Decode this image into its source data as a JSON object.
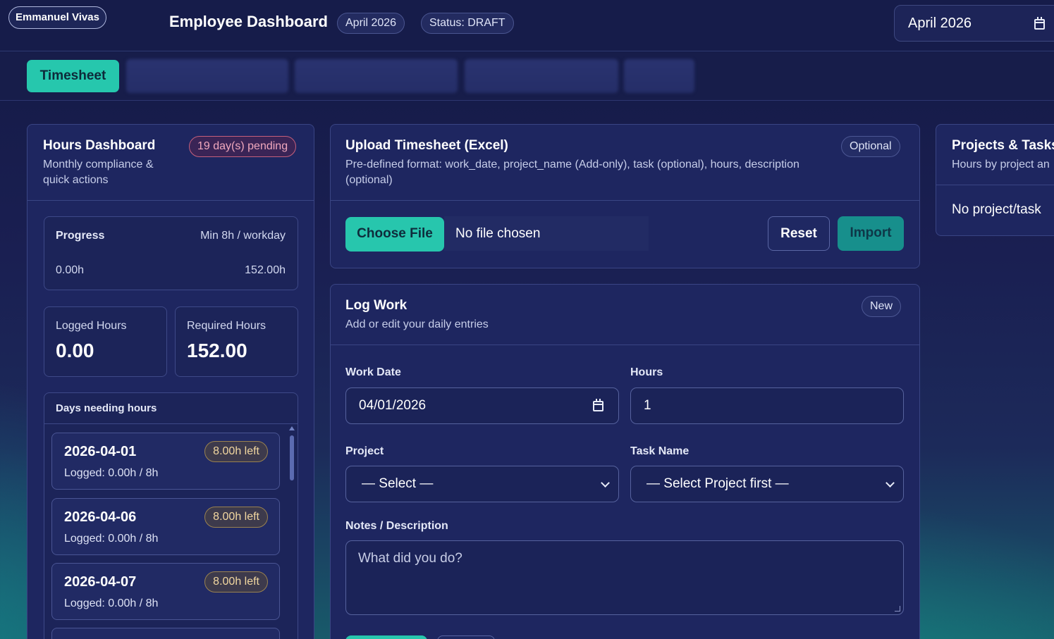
{
  "header": {
    "user_name": "Emmanuel Vivas",
    "title": "Employee Dashboard",
    "month_pill": "April 2026",
    "status_pill": "Status: DRAFT",
    "month_picker_value": "April 2026"
  },
  "tabs": {
    "active_label": "Timesheet"
  },
  "hours_dashboard": {
    "title": "Hours Dashboard",
    "subtitle": "Monthly compliance & quick actions",
    "pending_badge": "19 day(s) pending",
    "progress": {
      "label": "Progress",
      "min_label": "Min 8h / workday",
      "current": "0.00h",
      "target": "152.00h"
    },
    "logged": {
      "label": "Logged Hours",
      "value": "0.00"
    },
    "required": {
      "label": "Required Hours",
      "value": "152.00"
    },
    "days_needing": {
      "title": "Days needing hours",
      "items": [
        {
          "date": "2026-04-01",
          "badge": "8.00h left",
          "logged": "Logged: 0.00h / 8h"
        },
        {
          "date": "2026-04-06",
          "badge": "8.00h left",
          "logged": "Logged: 0.00h / 8h"
        },
        {
          "date": "2026-04-07",
          "badge": "8.00h left",
          "logged": "Logged: 0.00h / 8h"
        }
      ]
    }
  },
  "upload": {
    "title": "Upload Timesheet (Excel)",
    "subtitle": "Pre-defined format: work_date, project_name (Add-only), task (optional), hours, description (optional)",
    "badge": "Optional",
    "choose_label": "Choose File",
    "file_status": "No file chosen",
    "reset_label": "Reset",
    "import_label": "Import"
  },
  "log_work": {
    "title": "Log Work",
    "subtitle": "Add or edit your daily entries",
    "badge": "New",
    "work_date_label": "Work Date",
    "work_date_value": "04/01/2026",
    "hours_label": "Hours",
    "hours_value": "1",
    "project_label": "Project",
    "project_value": "— Select —",
    "task_label": "Task Name",
    "task_value": "— Select Project first —",
    "notes_label": "Notes / Description",
    "notes_placeholder": "What did you do?"
  },
  "projects": {
    "title": "Projects & Tasks",
    "subtitle": "Hours by project an",
    "empty_text": "No project/task"
  },
  "icons": {
    "calendar": "calendar-icon",
    "dropdown": "chevron-down-icon"
  }
}
